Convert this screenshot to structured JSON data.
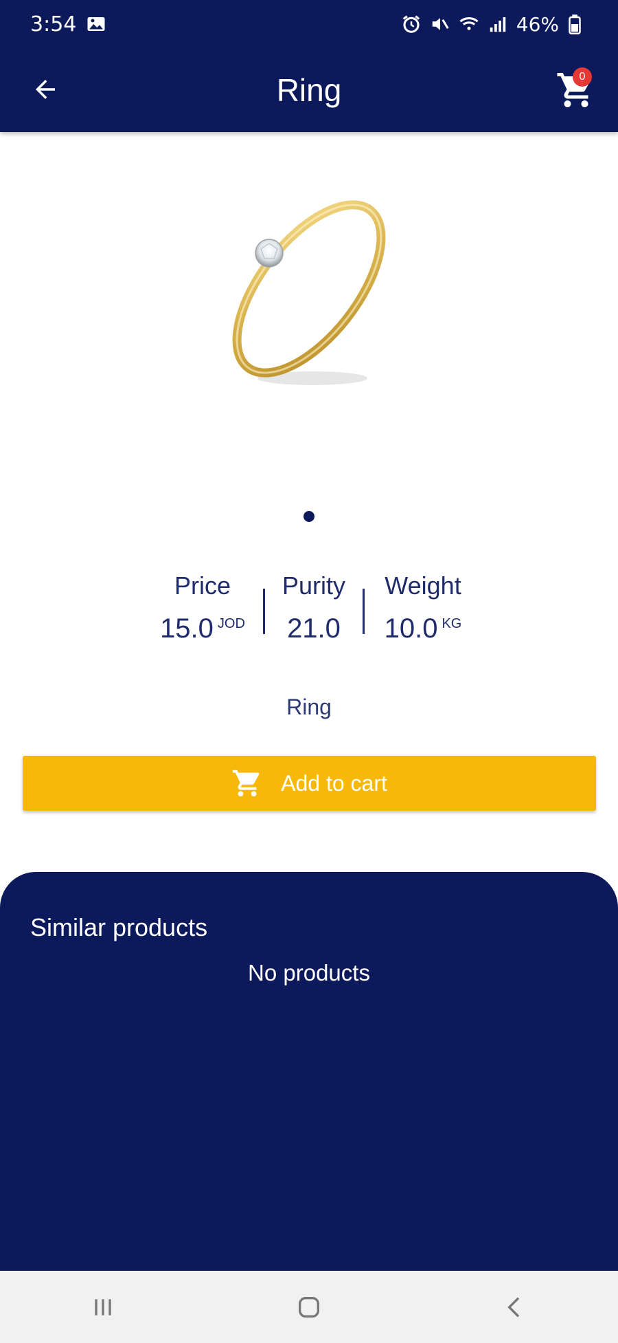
{
  "status_bar": {
    "time": "3:54",
    "battery": "46%",
    "icons": [
      "gallery-icon",
      "alarm-icon",
      "mute-icon",
      "wifi-icon",
      "signal-icon",
      "battery-icon"
    ]
  },
  "app_bar": {
    "title": "Ring",
    "cart_count": "0",
    "icons": [
      "back-arrow-icon",
      "cart-icon"
    ]
  },
  "product": {
    "image_alt": "ring-icon",
    "specs": {
      "price_label": "Price",
      "price_value": "15.0",
      "price_unit": "JOD",
      "purity_label": "Purity",
      "purity_value": "21.0",
      "weight_label": "Weight",
      "weight_value": "10.0",
      "weight_unit": "KG"
    },
    "name": "Ring",
    "add_to_cart_label": "Add to cart"
  },
  "similar": {
    "title": "Similar products",
    "empty_text": "No products"
  },
  "colors": {
    "primary": "#0c1a5c",
    "accent": "#f6b80a",
    "badge": "#e53935"
  }
}
